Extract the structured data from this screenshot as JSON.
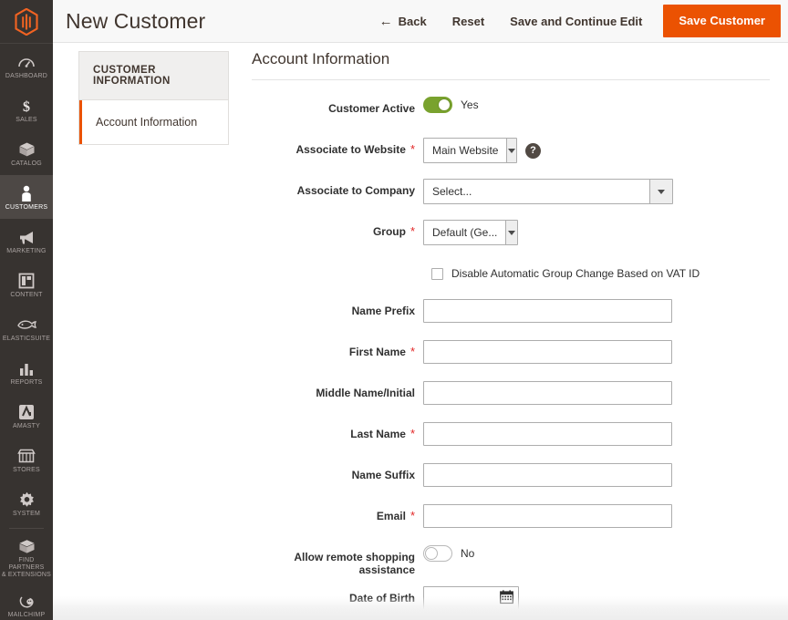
{
  "colors": {
    "accent_orange": "#eb5202",
    "sidebar_bg": "#373330",
    "sidebar_active_bg": "#4d4845",
    "toggle_on_green": "#79a22e",
    "required_red": "#e22626",
    "header_bg": "#f8f8f8"
  },
  "sidebar": {
    "logo_name": "magento-logo",
    "items": [
      {
        "label": "DASHBOARD",
        "icon": "dashboard-icon",
        "active": false
      },
      {
        "label": "SALES",
        "icon": "dollar-icon",
        "active": false
      },
      {
        "label": "CATALOG",
        "icon": "box-icon",
        "active": false
      },
      {
        "label": "CUSTOMERS",
        "icon": "person-icon",
        "active": true
      },
      {
        "label": "MARKETING",
        "icon": "megaphone-icon",
        "active": false
      },
      {
        "label": "CONTENT",
        "icon": "layout-icon",
        "active": false
      },
      {
        "label": "ELASTICSUITE",
        "icon": "fish-icon",
        "active": false
      },
      {
        "label": "REPORTS",
        "icon": "bar-chart-icon",
        "active": false
      },
      {
        "label": "AMASTY",
        "icon": "amasty-icon",
        "active": false
      },
      {
        "label": "STORES",
        "icon": "storefront-icon",
        "active": false
      },
      {
        "label": "SYSTEM",
        "icon": "gear-icon",
        "active": false
      },
      {
        "label": "FIND PARTNERS\n& EXTENSIONS",
        "icon": "package-icon",
        "active": false
      },
      {
        "label": "MAILCHIMP",
        "icon": "mailchimp-icon",
        "active": false
      }
    ]
  },
  "header": {
    "title": "New Customer",
    "back_label": "Back",
    "back_icon": "arrow-left-icon",
    "reset_label": "Reset",
    "save_continue_label": "Save and Continue Edit",
    "save_label": "Save Customer"
  },
  "tabs": {
    "heading": "CUSTOMER INFORMATION",
    "items": [
      {
        "label": "Account Information",
        "active": true
      }
    ]
  },
  "form": {
    "section_title": "Account Information",
    "customer_active": {
      "label": "Customer Active",
      "state_text": "Yes",
      "on": true
    },
    "associate_website": {
      "label": "Associate to Website",
      "required": true,
      "value": "Main Website",
      "help_icon": "help-icon",
      "help_glyph": "?"
    },
    "associate_company": {
      "label": "Associate to Company",
      "required": false,
      "value": "Select..."
    },
    "group": {
      "label": "Group",
      "required": true,
      "value": "Default (Ge..."
    },
    "disable_vat": {
      "label": "Disable Automatic Group Change Based on VAT ID",
      "checked": false
    },
    "name_prefix": {
      "label": "Name Prefix",
      "required": false,
      "value": "",
      "placeholder": ""
    },
    "first_name": {
      "label": "First Name",
      "required": true,
      "value": "",
      "placeholder": ""
    },
    "middle_name": {
      "label": "Middle Name/Initial",
      "required": false,
      "value": "",
      "placeholder": ""
    },
    "last_name": {
      "label": "Last Name",
      "required": true,
      "value": "",
      "placeholder": ""
    },
    "name_suffix": {
      "label": "Name Suffix",
      "required": false,
      "value": "",
      "placeholder": ""
    },
    "email": {
      "label": "Email",
      "required": true,
      "value": "",
      "placeholder": ""
    },
    "remote_assistance": {
      "label": "Allow remote shopping assistance",
      "state_text": "No",
      "on": false
    },
    "date_of_birth": {
      "label": "Date of Birth",
      "value": "",
      "placeholder": "",
      "icon": "calendar-icon"
    }
  }
}
